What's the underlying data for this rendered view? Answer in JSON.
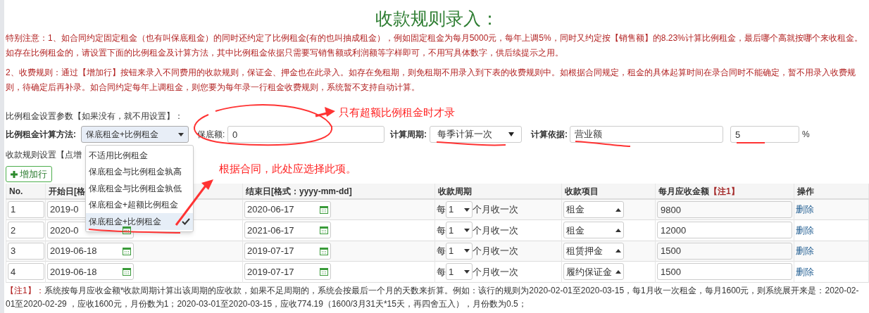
{
  "title": "收款规则录入：",
  "notes": [
    "特别注意：1、如合同约定固定租金（也有叫保底租金）的同时还约定了比例租金(有的也叫抽成租金），例如固定租金为每月5000元，每年上调5%，同时又约定按【销售额】的8.23%计算比例租金，最后哪个高就按哪个来收租金。如存在比例租金的，请设置下面的比例租金及计算方法，其中比例租金依据只需要写销售额或利润额等字样即可，不用写具体数字，供后续提示之用。",
    "2、收费规则：通过【增加行】按钮来录入不同费用的收款规则，保证金、押金也在此录入。如存在免租期，则免租期不用录入到下表的收费规则中。如根据合同规定，租金的具体起算时间在录合同时不能确定，暂不用录入收费规则，待确定后再补录。如合同约定每年上调租金，则您要为每年录一行租金收费规则，系统暂不支持自动计算。"
  ],
  "ratio_section": {
    "heading": "比例租金设置参数【如果没有，就不用设置】：",
    "method_label": "比例租金计算方法:",
    "method_value": "保底租金+比例租金",
    "minimum_label": "保底额:",
    "minimum_value": "0",
    "period_label": "计算周期:",
    "period_value": "每季计算一次",
    "basis_label": "计算依据:",
    "basis_value": "营业额",
    "rate_value": "5",
    "rate_unit": "%"
  },
  "method_options": [
    {
      "label": "不适用比例租金",
      "selected": false
    },
    {
      "label": "保底租金与比例租金孰高",
      "selected": false
    },
    {
      "label": "保底租金与比例租金孰低",
      "selected": false
    },
    {
      "label": "保底租金+超额比例租金",
      "selected": false
    },
    {
      "label": "保底租金+比例租金",
      "selected": true
    }
  ],
  "rules_heading": "收款规则设置【点增",
  "add_row_button": "增加行",
  "table": {
    "columns": [
      "No.",
      "开始日[格",
      "结束日[格式：yyyy-mm-dd]",
      "收款周期",
      "收款项目",
      "每月应收金额",
      "操作"
    ],
    "amount_note_mark": "【注1】",
    "rows": [
      {
        "no": "1",
        "start": "2019-0",
        "start_icon_shown": false,
        "end": "2020-06-17",
        "every": "每",
        "months": "1",
        "per": "个月收一次",
        "item": "租金",
        "amount": "9800",
        "action": "删除"
      },
      {
        "no": "2",
        "start": "2020-0",
        "start_icon_shown": true,
        "end": "2021-06-17",
        "every": "每",
        "months": "1",
        "per": "个月收一次",
        "item": "租金",
        "amount": "12000",
        "action": "删除"
      },
      {
        "no": "3",
        "start": "2019-06-18",
        "start_icon_shown": true,
        "end": "2019-07-17",
        "every": "每",
        "months": "1",
        "per": "个月收一次",
        "item": "租赁押金",
        "amount": "1500",
        "action": "删除"
      },
      {
        "no": "4",
        "start": "2019-06-18",
        "start_icon_shown": true,
        "end": "2019-07-17",
        "every": "每",
        "months": "1",
        "per": "个月收一次",
        "item": "履约保证金",
        "amount": "1500",
        "action": "删除"
      }
    ]
  },
  "footnote": {
    "mark": "【注1】：",
    "text": "系统按每月应收金额*收款周期计算出该周期的应收款，如果不足周期的，系统会按最后一个月的天数来折算。例如：该行的规则为2020-02-01至2020-03-15，每1月收一次租金，每月1600元，则系统展开来是：2020-02-01至2020-02-29 ，应收1600元，月份数为1；2020-03-01至2020-03-15，应收774.19（1600/3月31天*15天，再四舍五入），月份数为0.5；"
  },
  "callouts": [
    "只有超额比例租金时才录",
    "根据合同，此处应选择此项。"
  ]
}
